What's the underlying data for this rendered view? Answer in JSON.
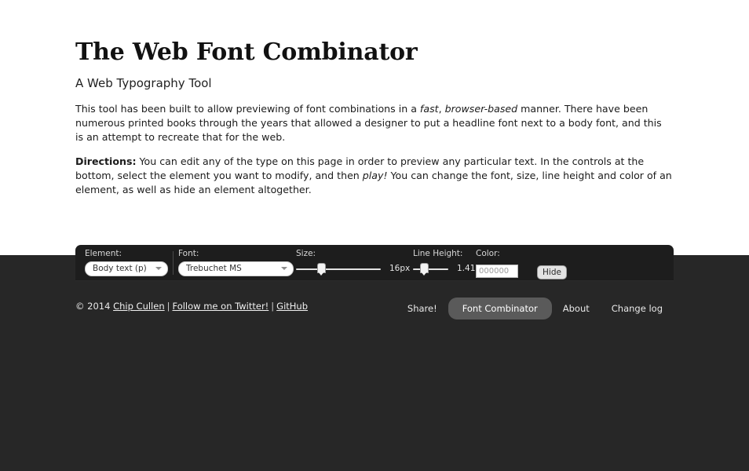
{
  "preview": {
    "title": "The Web Font Combinator",
    "subtitle": "A Web Typography Tool",
    "paragraph1_part1": "This tool has been built to allow previewing of font combinations in a ",
    "paragraph1_em1": "fast",
    "paragraph1_part2": ", ",
    "paragraph1_em2": "browser-based",
    "paragraph1_part3": " manner. There have been numerous printed books through the years that allowed a designer to put a headline font next to a body font, and this is an attempt to recreate that for the web.",
    "paragraph2_strong": "Directions:",
    "paragraph2_part1": " You can edit any of the type on this page in order to preview any particular text. In the controls at the bottom, select the element you want to modify, and then ",
    "paragraph2_em1": "play!",
    "paragraph2_part2": " You can change the font, size, line height and color of an element, as well as hide an element altogether."
  },
  "controls": {
    "element_label": "Element:",
    "element_value": "Body text (p)",
    "font_label": "Font:",
    "font_value": "Trebuchet MS",
    "size_label": "Size:",
    "size_value": "16px",
    "size_percent": 30,
    "line_height_label": "Line Height:",
    "line_height_value": "1.41",
    "line_height_percent": 33,
    "color_label": "Color:",
    "color_value": "000000",
    "color_placeholder": "000000",
    "hide_label": "Hide"
  },
  "footer": {
    "copyright": "© 2014 ",
    "author_link": "Chip Cullen",
    "separator": "|",
    "twitter_link": "Follow me on Twitter!",
    "github_link": "GitHub",
    "share_label": "Share!",
    "nav": [
      {
        "label": "Font Combinator",
        "active": true
      },
      {
        "label": "About",
        "active": false
      },
      {
        "label": "Change log",
        "active": false
      }
    ]
  }
}
